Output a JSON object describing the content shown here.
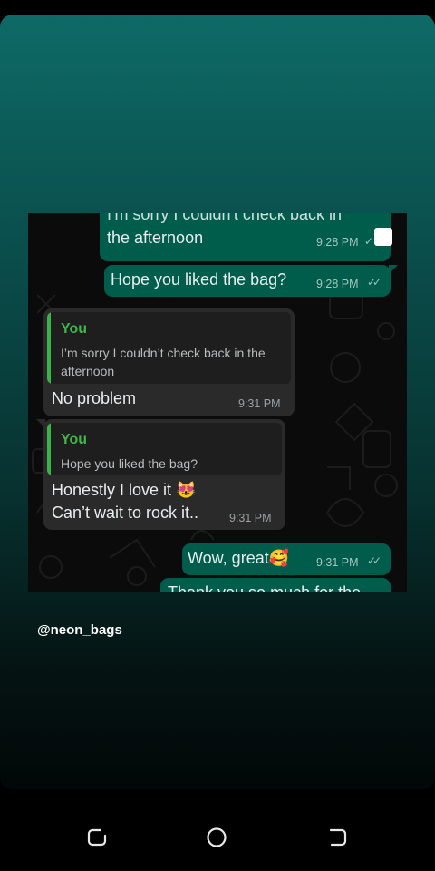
{
  "chat": {
    "messages": [
      {
        "id": "m1",
        "text_cut": "I'm sorry I couldn't check back in",
        "text": "the afternoon",
        "time": "9:28 PM"
      },
      {
        "id": "m2",
        "text": "Hope you liked the bag?",
        "time": "9:28 PM"
      },
      {
        "id": "m3",
        "quote_author": "You",
        "quote_line1": "I’m sorry I couldn’t check back in the",
        "quote_line2": "afternoon",
        "text": "No problem",
        "time": "9:31 PM"
      },
      {
        "id": "m4",
        "quote_author": "You",
        "quote_line1": "Hope you liked the bag?",
        "text_line1": "Honestly I love it 😻",
        "text_line2": "Can’t wait to rock it..",
        "time": "9:31 PM"
      },
      {
        "id": "m5",
        "text": "Wow, great🥰",
        "time": "9:31 PM"
      },
      {
        "id": "m6",
        "text": "Thank you so much for the"
      }
    ]
  },
  "story": {
    "handle": "@neon_bags",
    "colors": {
      "outgoing_bubble": "#005c4b",
      "incoming_bubble": "#2a2a2a",
      "quote_accent": "#3fb54a"
    }
  },
  "nav": {
    "icons": [
      "recent-apps-icon",
      "home-icon",
      "back-icon"
    ]
  }
}
